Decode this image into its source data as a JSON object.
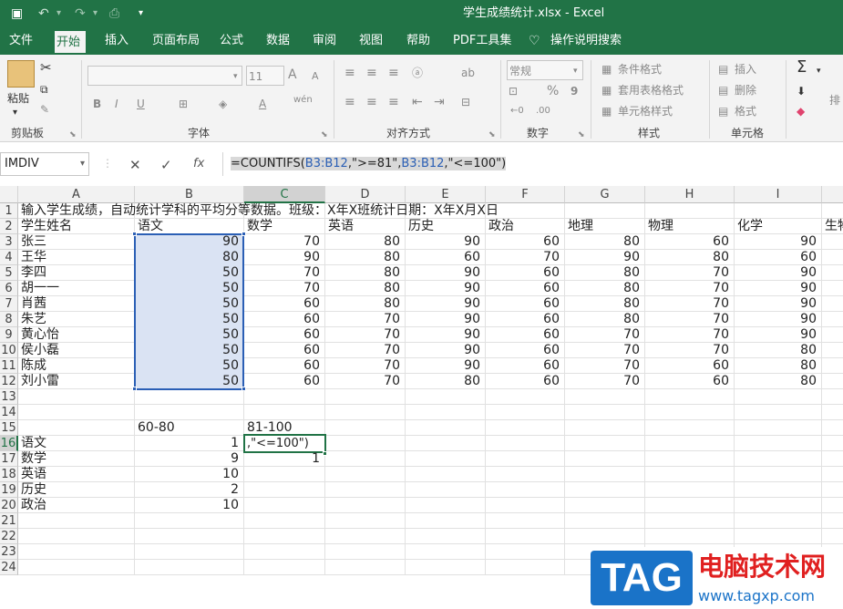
{
  "title_bar": {
    "title": "学生成绩统计.xlsx  -  Excel",
    "save_icon": "save-icon",
    "undo_icon": "undo-icon",
    "redo_icon": "redo-icon"
  },
  "ribbon_tabs": [
    "文件",
    "开始",
    "插入",
    "页面布局",
    "公式",
    "数据",
    "审阅",
    "视图",
    "帮助",
    "PDF工具集",
    "操作说明搜索"
  ],
  "active_tab": "开始",
  "ribbon": {
    "clipboard": {
      "paste": "粘贴",
      "label": "剪贴板"
    },
    "font": {
      "size": "11",
      "label": "字体",
      "bold": "B",
      "italic": "I",
      "underline": "U",
      "grow": "A",
      "shrink": "A",
      "wen": "wén",
      "font_color": "A"
    },
    "alignment": {
      "label": "对齐方式"
    },
    "number": {
      "format": "常规",
      "label": "数字",
      "percent": "%",
      "comma": "9"
    },
    "styles": {
      "conditional": "条件格式",
      "table": "套用表格格式",
      "cell": "单元格样式",
      "label": "样式"
    },
    "cells": {
      "insert": "插入",
      "delete": "删除",
      "format": "格式",
      "label": "单元格"
    },
    "editing": {
      "label": "排",
      "sigma": "Σ"
    }
  },
  "formula_bar": {
    "name_box": "IMDIV",
    "cancel": "✕",
    "enter": "✓",
    "fx": "fx",
    "parts": [
      "=COUNTIFS(",
      "B3:B12",
      ",\">=81\",",
      "B3:B12",
      ",\"<=100\")"
    ]
  },
  "columns": [
    "A",
    "B",
    "C",
    "D",
    "E",
    "F",
    "G",
    "H",
    "I"
  ],
  "rows": [
    "1",
    "2",
    "3",
    "4",
    "5",
    "6",
    "7",
    "8",
    "9",
    "10",
    "11",
    "12",
    "13",
    "14",
    "15",
    "16",
    "17",
    "18",
    "19",
    "20",
    "21",
    "22",
    "23",
    "24"
  ],
  "sheet": {
    "row1": "输入学生成绩，自动统计学科的平均分等数据。班级：X年X班统计日期：X年X月X日",
    "headers": [
      "学生姓名",
      "语文",
      "数学",
      "英语",
      "历史",
      "政治",
      "地理",
      "物理",
      "化学",
      "生物"
    ],
    "students": [
      {
        "name": "张三",
        "scores": [
          90,
          70,
          80,
          90,
          60,
          80,
          60,
          90
        ]
      },
      {
        "name": "王华",
        "scores": [
          80,
          90,
          80,
          60,
          70,
          90,
          80,
          60
        ]
      },
      {
        "name": "李四",
        "scores": [
          50,
          70,
          80,
          90,
          60,
          80,
          70,
          90
        ]
      },
      {
        "name": "胡一一",
        "scores": [
          50,
          70,
          80,
          90,
          60,
          80,
          70,
          90
        ]
      },
      {
        "name": "肖茜",
        "scores": [
          50,
          60,
          80,
          90,
          60,
          80,
          70,
          90
        ]
      },
      {
        "name": "朱艺",
        "scores": [
          50,
          60,
          70,
          90,
          60,
          80,
          70,
          90
        ]
      },
      {
        "name": "黄心怡",
        "scores": [
          50,
          60,
          70,
          90,
          60,
          70,
          70,
          90
        ]
      },
      {
        "name": "侯小磊",
        "scores": [
          50,
          60,
          70,
          90,
          60,
          70,
          70,
          80
        ]
      },
      {
        "name": "陈成",
        "scores": [
          50,
          60,
          70,
          90,
          60,
          70,
          60,
          80
        ]
      },
      {
        "name": "刘小雷",
        "scores": [
          50,
          60,
          70,
          80,
          60,
          70,
          60,
          80
        ]
      }
    ],
    "range_header": [
      "60-80",
      "81-100"
    ],
    "stats": [
      {
        "subject": "语文",
        "b": "1",
        "c": ",\"<=100\")"
      },
      {
        "subject": "数学",
        "b": "9",
        "c": "1"
      },
      {
        "subject": "英语",
        "b": "10",
        "c": ""
      },
      {
        "subject": "历史",
        "b": "2",
        "c": ""
      },
      {
        "subject": "政治",
        "b": "10",
        "c": ""
      }
    ]
  },
  "watermark": {
    "tag": "TAG",
    "name": "电脑技术网",
    "url": "www.tagxp.com"
  }
}
